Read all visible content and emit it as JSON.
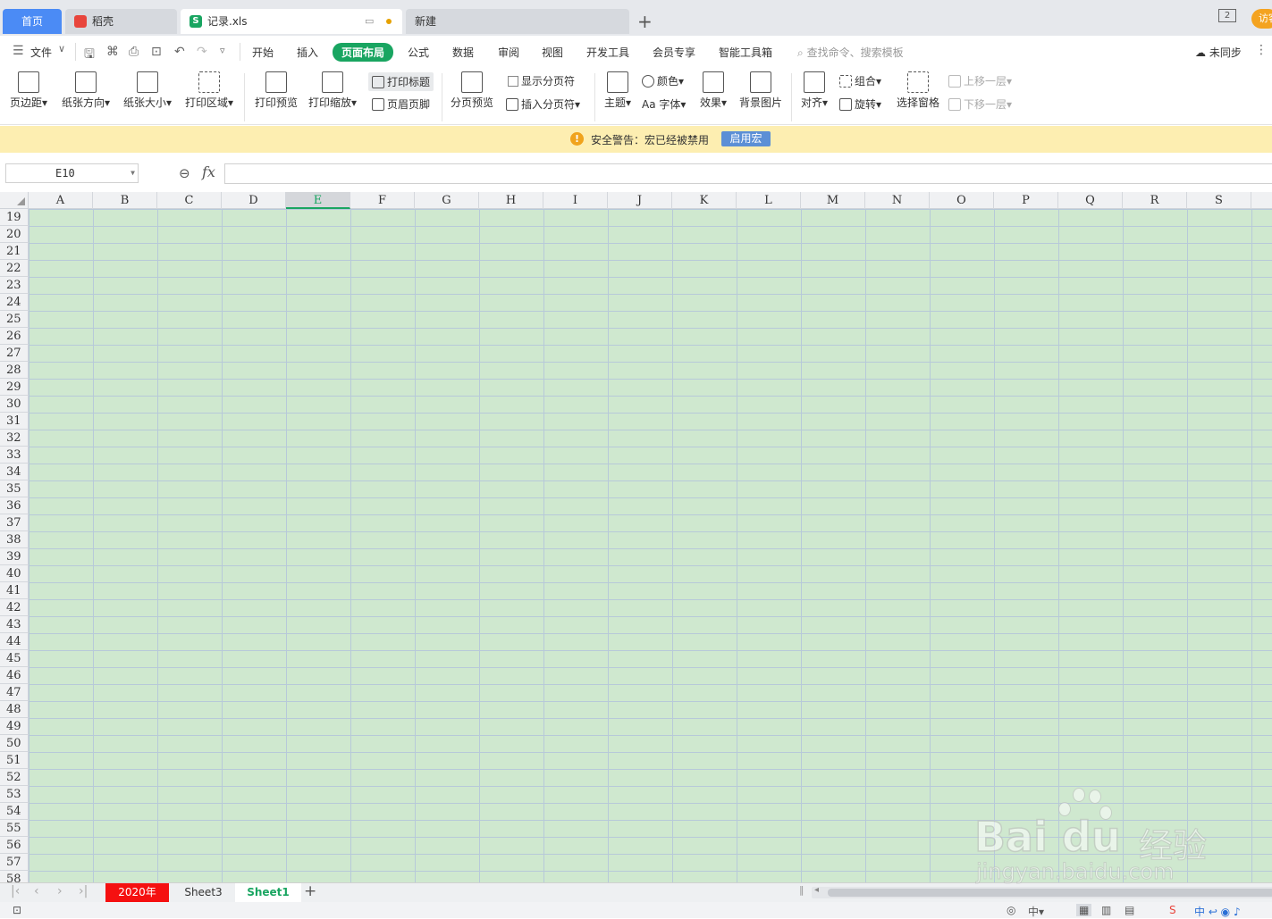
{
  "tabs": {
    "home": "首页",
    "daoke": "稻壳",
    "file": "记录.xls",
    "new": "新建",
    "plus": "+",
    "window_count": "2",
    "visit": "访客"
  },
  "menu": {
    "file": "文件",
    "items": [
      "开始",
      "插入",
      "页面布局",
      "公式",
      "数据",
      "审阅",
      "视图",
      "开发工具",
      "会员专享",
      "智能工具箱"
    ],
    "active": "页面布局",
    "search": "查找命令、搜索模板",
    "sync": "未同步"
  },
  "ribbon": {
    "margins": "页边距",
    "orientation": "纸张方向",
    "size": "纸张大小",
    "print_area": "打印区域",
    "print_preview": "打印预览",
    "print_scale": "打印缩放",
    "print_titles": "打印标题",
    "header_footer": "页眉页脚",
    "page_break_preview": "分页预览",
    "show_page_breaks": "显示分页符",
    "insert_page_break": "插入分页符",
    "theme": "主题",
    "colors": "颜色",
    "fonts": "字体",
    "fonts_prefix": "Aa",
    "effects": "效果",
    "background": "背景图片",
    "align": "对齐",
    "group": "组合",
    "rotate": "旋转",
    "selection_pane": "选择窗格",
    "bring_forward": "上移一层",
    "send_backward": "下移一层"
  },
  "warning": {
    "text": "安全警告：宏已经被禁用",
    "button": "启用宏",
    "icon": "!"
  },
  "formula_bar": {
    "name_box": "E10",
    "fx": "fx",
    "value": ""
  },
  "grid": {
    "columns": [
      "A",
      "B",
      "C",
      "D",
      "E",
      "F",
      "G",
      "H",
      "I",
      "J",
      "K",
      "L",
      "M",
      "N",
      "O",
      "P",
      "Q",
      "R",
      "S"
    ],
    "selected_column": "E",
    "rows": [
      "19",
      "20",
      "21",
      "22",
      "23",
      "24",
      "25",
      "26",
      "27",
      "28",
      "29",
      "30",
      "31",
      "32",
      "33",
      "34",
      "35",
      "36",
      "37",
      "38",
      "39",
      "40",
      "41",
      "42",
      "43",
      "44",
      "45",
      "46",
      "47",
      "48",
      "49",
      "50",
      "51",
      "52",
      "53",
      "54",
      "55",
      "56",
      "57",
      "58"
    ],
    "cell_bg": "#cfe8cf"
  },
  "sheets": {
    "names": [
      "2020年",
      "Sheet3",
      "Sheet1"
    ],
    "active": "Sheet1",
    "add": "+"
  },
  "watermark": {
    "brand": "Bai du",
    "cn": "经验",
    "url": "jingyan.baidu.com"
  }
}
